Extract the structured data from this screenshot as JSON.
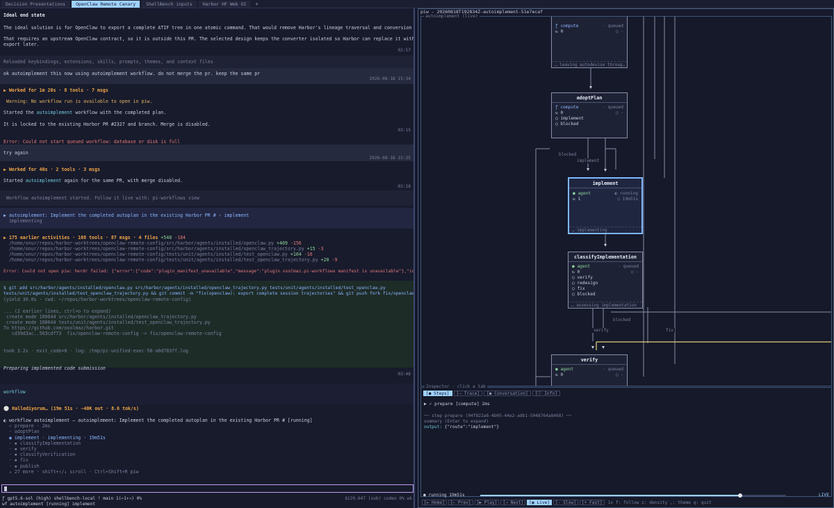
{
  "tabs": [
    {
      "label": "Decision Presentations"
    },
    {
      "label": "OpenClaw Remote Canary"
    },
    {
      "label": "ShellBench inputs"
    },
    {
      "label": "Harbor HF Web UI"
    }
  ],
  "tab_add": "+",
  "conversation": {
    "heading": "Ideal end state",
    "para1": "The ideal solution is for OpenClaw to export a complete ATIF tree in one atomic command. That would remove Harbor's lineage traversal and conversion code.",
    "para2a": "That requires an upstream OpenClaw contract, so it is outside this PR. The selected design keeps the converter isolated so Harbor can replace it with native OpenClaw ATIF",
    "para2b": "export later.",
    "ts1": "02:57",
    "reloaded": "Reloaded keybindings, extensions, skills, prompts, themes, and context files",
    "user1": "ok autoimplement this now using autoimplement workflow. do not merge the pr. keep the same pr",
    "user1_ts": "2026-08-18 15:34",
    "worked1": "▶ Worked for 1m 20s · 8 tools · 7 msgs",
    "warning": " Warning: No workflow run is available to open in piw.",
    "started1_pre": "Started the ",
    "started1_kw": "autoimplement",
    "started1_post": " workflow with the completed plan.",
    "locked": "It is locked to the existing Harbor PR #2327 and branch. Merge is disabled.",
    "ts2": "03:15",
    "err1": "Error: Could not start queued workflow: database or disk is full",
    "user2": "try again",
    "user2_ts": "2026-08-18 15:35",
    "worked2": "▶ Worked for 40s · 2 tools · 3 msgs",
    "started2_pre": "Started ",
    "started2_kw": "autoimplement",
    "started2_post": " again for the same PR, with merge disabled.",
    "ts3": "03:28",
    "wf_started": " Workflow autoimplement started. Follow it live with: pi-workflows view",
    "wf_line1": "▶ autoimplement: Implement the completed autoplan in the existing Harbor PR # › implement",
    "wf_line2": "  implementing",
    "earlier_pre": "▶ 175 earlier activities · 108 tools · 87 msgs · 4 files ",
    "earlier_add": "+548",
    "earlier_del": " -184",
    "files": [
      {
        "path": "  /home/onur/repos/harbor-worktrees/openclaw-remote-config/src/harbor/agents/installed/openclaw.py ",
        "add": "+409",
        "del": " -156"
      },
      {
        "path": "  /home/onur/repos/harbor-worktrees/openclaw-remote-config/src/harbor/agents/installed/openclaw_trajectory.py ",
        "add": "+15",
        "del": " -3"
      },
      {
        "path": "  /home/onur/repos/harbor-worktrees/openclaw-remote-config/tests/unit/agents/installed/test_openclaw.py ",
        "add": "+104",
        "del": " -16"
      },
      {
        "path": "  /home/onur/repos/harbor-worktrees/openclaw-remote-config/tests/unit/agents/installed/test_openclaw_trajectory.py ",
        "add": "+20",
        "del": " -9"
      }
    ],
    "err2": "Error: Could not open piw: herdr failed: {\"error\":{\"code\":\"plugin_manifest_unavailable\",\"message\":\"plugin osolmaz.pi-workflows manifest is unavailable\"},\"id\":\"cli:plugin\"}",
    "cmd1": "$ git add src/harbor/agents/installed/openclaw.py src/harbor/agents/installed/openclaw_trajectory.py tests/unit/agents/installed/test_openclaw.py",
    "cmd2": "tests/unit/agents/installed/test_openclaw_trajectory.py && git commit -m \"fix(openclaw): export complete session trajectories\" && git push fork fix/openclaw-remote-config",
    "cmd3": "(yield 30.0s · cwd: ~/repos/harbor-worktrees/openclaw-remote-config)",
    "out1": "... (2 earlier lines, ctrl+o to expand)",
    "out2": " create mode 100644 src/harbor/agents/installed/openclaw_trajectory.py",
    "out3": " create mode 100644 tests/unit/agents/installed/test_openclaw_trajectory.py",
    "out4": "To https://github.com/osolmaz/harbor.git",
    "out5": "   cd39d3ac..563cdf73  fix/openclaw-remote-config -> fix/openclaw-remote-config",
    "took": "took 3.2s · exit_code=0 · log: /tmp/pi-unified-exec-50-a0d783ff.log",
    "preparing": "Preparing implemented code submission",
    "ts4": "03:48",
    "workflow_word": "workflow",
    "spinner_line": "⚪ Hallediyorum… (19m 51s · ~40K out · 8.6 tok/s)",
    "wf_status": "◐ workflow autoimplement — autoimplement: Implement the completed autoplan in the existing Harbor PR # [running]",
    "steps": [
      {
        "text": "  ✓ prepare · 2ms",
        "cls": "dim"
      },
      {
        "text": "  · adoptPlan",
        "cls": "dim"
      },
      {
        "text": "  ◉ implement · implementing · 19m51s",
        "cls": "cur"
      },
      {
        "text": "  · ▪ classifyImplementation",
        "cls": "dim"
      },
      {
        "text": "  · ▪ verify",
        "cls": "dim"
      },
      {
        "text": "  · ▪ classifyVerification",
        "cls": "dim"
      },
      {
        "text": "  · ▪ fix",
        "cls": "dim"
      },
      {
        "text": "  · ▪ publish",
        "cls": "dim"
      },
      {
        "text": "  ↓ 27 more · shift+↑/↓ scroll · Ctrl+Shift+R piw",
        "cls": "dim"
      }
    ]
  },
  "statusbar": {
    "left": "ƒ gpt5.6-sol (high) shellbench-local ᚠ main 1(⇐1⇑⇒) 0%",
    "right": "$120.647 (sub) codex 0% wk",
    "line2": "wf autoimplement [running] implement"
  },
  "piw": {
    "title": "piw - 20260818T192834Z-autoimplement-51e7ecaf",
    "subtitle": "autoimplement (live)",
    "nodes": {
      "n0": {
        "r1": "ƒ compute",
        "r1s": "· queued",
        "r2": "↻ 0",
        "r2s": "○ -",
        "foot": "… leaving autodevise throug…"
      },
      "adoptPlan": {
        "title": "adoptPlan",
        "r1": "ƒ compute",
        "r1s": "· queued",
        "r2": "↻ 0",
        "r2s": "○ -",
        "o1": "○ implement",
        "o2": "○ blocked"
      },
      "implement": {
        "title": "implement",
        "r1": "● agent",
        "r1s": "◐ running",
        "r2": "↻ 1",
        "r2s": "○ 19m51s",
        "foot": "… implementing"
      },
      "classify": {
        "title": "classifyImplementation",
        "r1": "● agent",
        "r1s": "· queued",
        "r2": "↻ 0",
        "r2s": "○ -",
        "o1": "○ verify",
        "o2": "○ redesign",
        "o3": "○ fix",
        "o4": "○ blocked",
        "foot": "… assessing implementation"
      },
      "verify": {
        "title": "verify",
        "r1": "● agent",
        "r1s": "· queued",
        "r2": "↻ 0",
        "r2s": "○ -"
      }
    },
    "edges": {
      "blocked1": "blocked",
      "implement": "implement",
      "blocked2": "blocked",
      "verify": "verify",
      "fix": "fix"
    },
    "inspector": {
      "label": "Inspector · click a tab",
      "tabs": [
        "[● Steps]",
        "[⇢ Trace]",
        "[● Conversation]",
        "[ⓘ Info]"
      ],
      "step_line": "▶ ✓ prepare [compute] 2ms",
      "detail_head": "── step prepare (04f822a8-4b05-44e2-adb1-5048764a8468) ──",
      "summary": "summary (Enter to expand)",
      "output_label": "output:",
      "output_value": " {\"route\":\"implement\"}"
    },
    "footer": {
      "running": "● running 19m51s",
      "live": "LIVE",
      "progress": 0.85,
      "controls": [
        "[⇤ Home]",
        "[⇠ Prev]",
        "[▶ Play]",
        "[⇢ Next]",
        "[◉ Live]",
        "[- Slow]",
        "[+ Fast]"
      ],
      "hints": "1x  f: follow  z: density  ,: theme  q: quit"
    }
  }
}
